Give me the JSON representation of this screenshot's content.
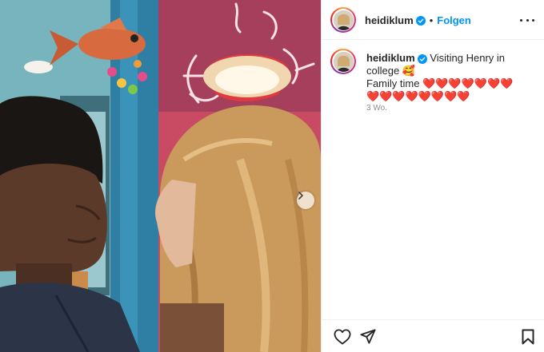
{
  "post": {
    "username": "heidiklum",
    "follow_label": "Folgen",
    "separator": "•",
    "caption_line1": "Visiting Henry in",
    "caption_line2": "college 🥰",
    "caption_line3": "Family time ❤️❤️❤️❤️❤️❤️❤️",
    "caption_line4": "❤️❤️❤️❤️❤️❤️❤️❤️",
    "timestamp": "3 Wo."
  },
  "icons": {
    "verified": "verified-badge-icon",
    "more": "more-options-icon",
    "like": "heart-outline-icon",
    "share": "paper-plane-icon",
    "save": "bookmark-icon",
    "next": "chevron-right-icon"
  },
  "colors": {
    "accent": "#0095f6",
    "text": "#262626",
    "muted": "#8e8e8e",
    "border": "#efefef"
  }
}
